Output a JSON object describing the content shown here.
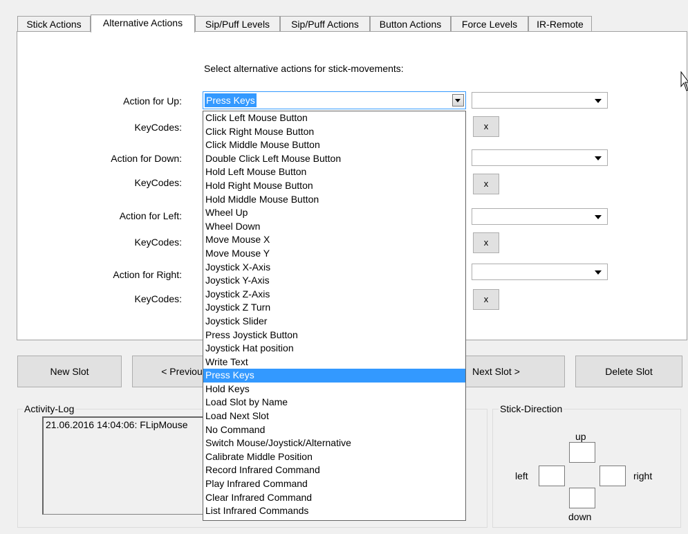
{
  "tabs": [
    {
      "label": "Stick Actions",
      "active": false
    },
    {
      "label": "Alternative Actions",
      "active": true
    },
    {
      "label": "Sip/Puff Levels",
      "active": false
    },
    {
      "label": "Sip/Puff Actions",
      "active": false
    },
    {
      "label": "Button Actions",
      "active": false
    },
    {
      "label": "Force Levels",
      "active": false
    },
    {
      "label": "IR-Remote",
      "active": false
    }
  ],
  "panel": {
    "heading": "Select alternative actions for stick-movements:",
    "rows": [
      {
        "action_label": "Action for Up:",
        "keycodes_label": "KeyCodes:",
        "clear_label": "x"
      },
      {
        "action_label": "Action for Down:",
        "keycodes_label": "KeyCodes:",
        "clear_label": "x"
      },
      {
        "action_label": "Action for Left:",
        "keycodes_label": "KeyCodes:",
        "clear_label": "x"
      },
      {
        "action_label": "Action for Right:",
        "keycodes_label": "KeyCodes:",
        "clear_label": "x"
      }
    ]
  },
  "dropdown": {
    "selected": "Press Keys",
    "options": [
      "Click Left Mouse Button",
      "Click Right Mouse Button",
      "Click Middle Mouse Button",
      "Double Click Left Mouse Button",
      "Hold Left Mouse Button",
      "Hold Right Mouse Button",
      "Hold Middle Mouse Button",
      "Wheel Up",
      "Wheel Down",
      "Move Mouse X",
      "Move Mouse Y",
      "Joystick X-Axis",
      "Joystick Y-Axis",
      "Joystick Z-Axis",
      "Joystick Z Turn",
      "Joystick Slider",
      "Press Joystick Button",
      "Joystick Hat position",
      "Write Text",
      "Press Keys",
      "Hold Keys",
      "Load Slot by Name",
      "Load Next Slot",
      "No Command",
      "Switch Mouse/Joystick/Alternative",
      "Calibrate Middle Position",
      "Record Infrared Command",
      "Play Infrared Command",
      "Clear Infrared Command",
      "List Infrared Commands"
    ],
    "highlighted_index": 19
  },
  "buttons": {
    "new_slot": "New Slot",
    "previous_slot": "< Previous",
    "next_slot": "Next  Slot >",
    "delete_slot": "Delete Slot"
  },
  "activity_log": {
    "title": "Activity-Log",
    "entries": [
      "21.06.2016 14:04:06: FLipMouse"
    ]
  },
  "stick_direction": {
    "title": "Stick-Direction",
    "up": "up",
    "down": "down",
    "left": "left",
    "right": "right"
  },
  "colors": {
    "selection": "#3399ff",
    "panel": "#ffffff",
    "window": "#f0f0f0"
  }
}
